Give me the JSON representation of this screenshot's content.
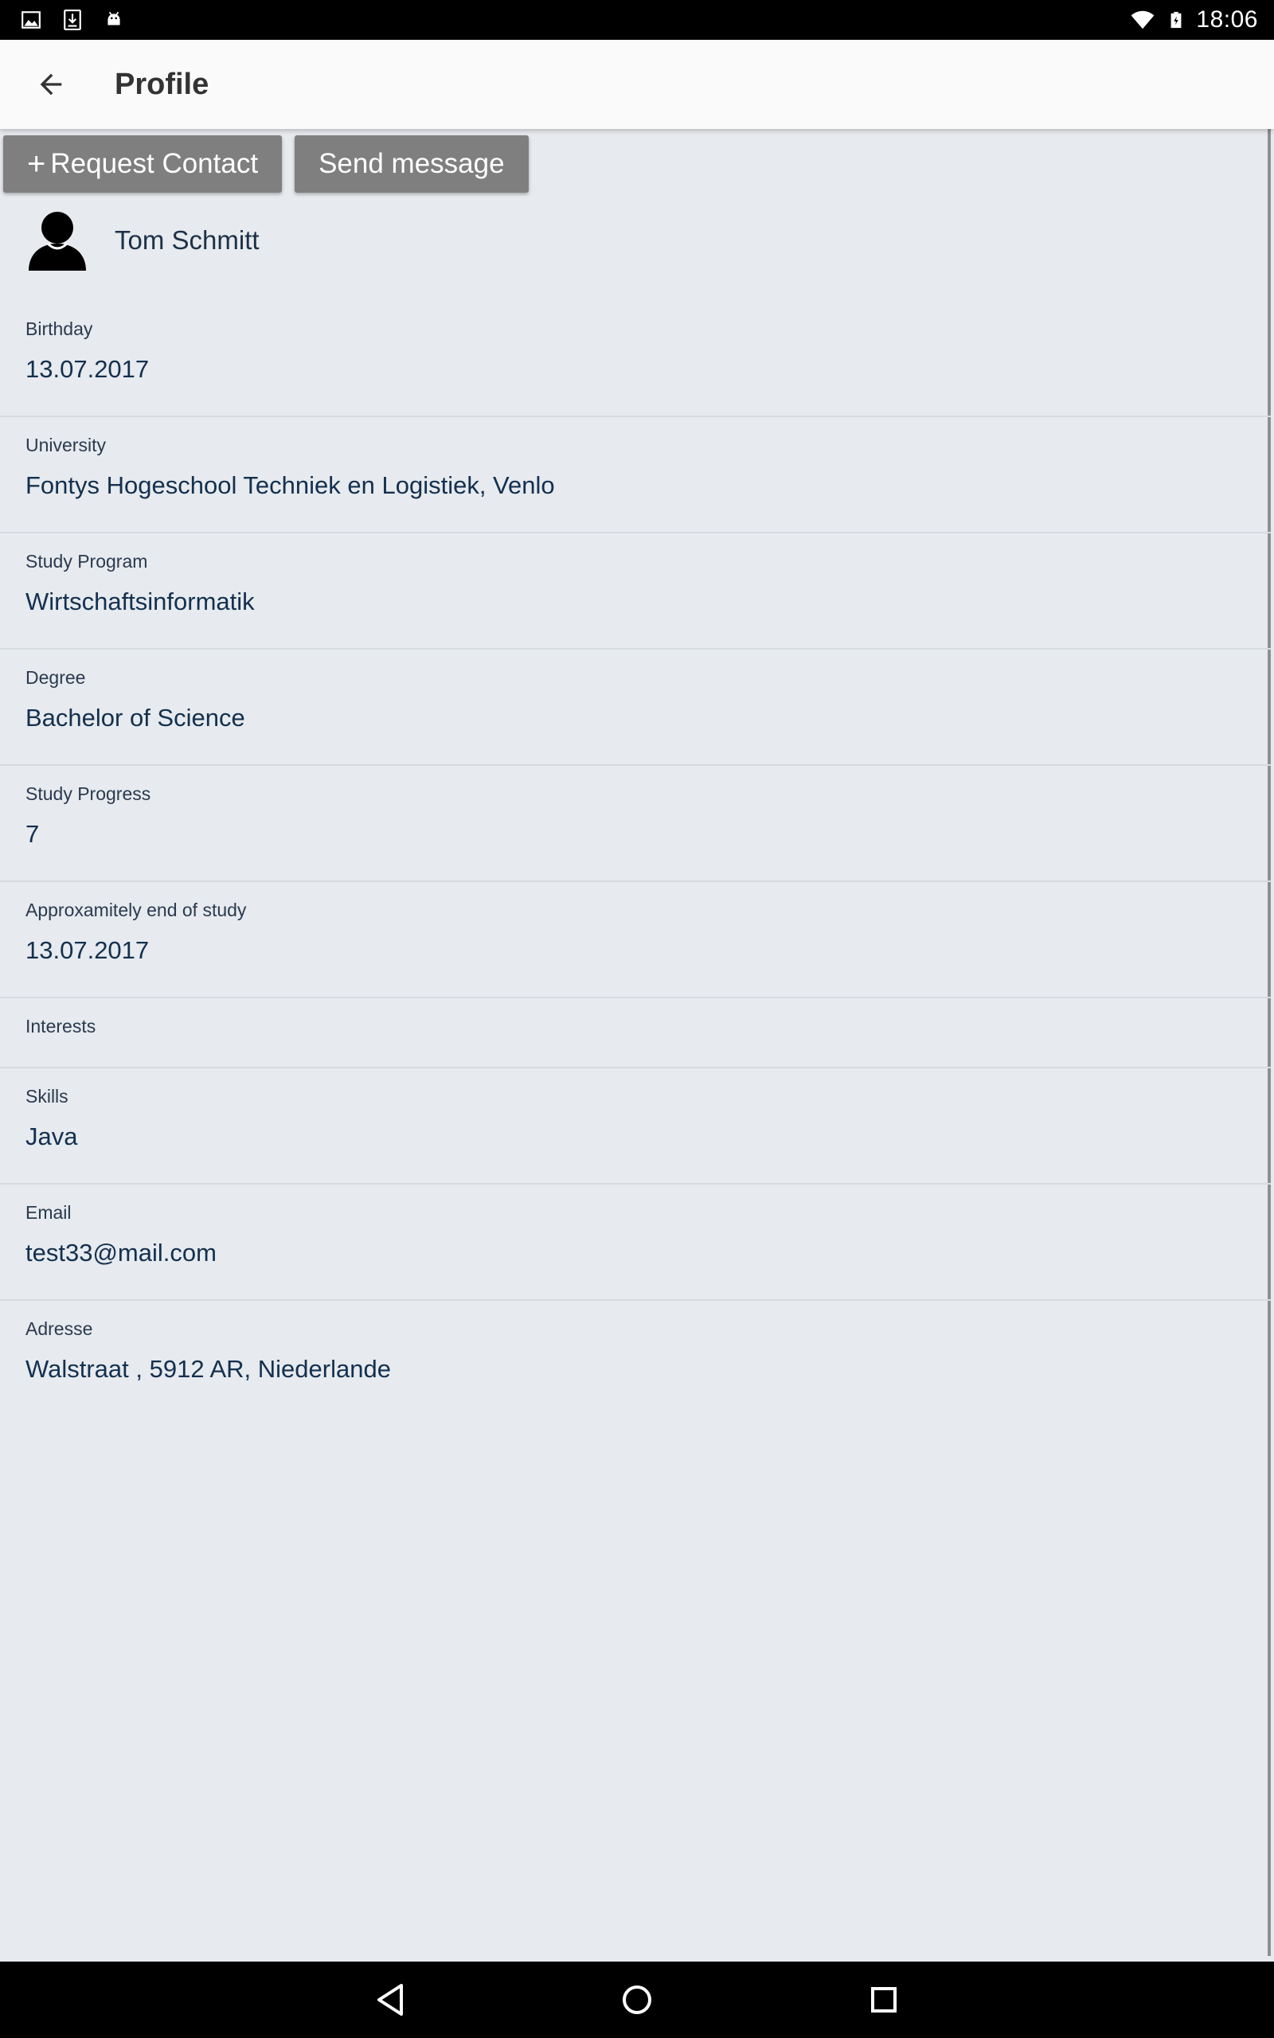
{
  "status_bar": {
    "time": "18:06",
    "left_icons": [
      "image-icon",
      "download-icon",
      "android-icon"
    ],
    "right_icons": [
      "wifi-icon",
      "battery-icon"
    ]
  },
  "app_bar": {
    "title": "Profile",
    "back_icon": "arrow-back-icon"
  },
  "actions": {
    "request_contact_label": "Request Contact",
    "request_contact_icon": "+",
    "send_message_label": "Send message"
  },
  "profile": {
    "name": "Tom Schmitt",
    "avatar_icon": "person-icon"
  },
  "fields": [
    {
      "label": "Birthday",
      "value": "13.07.2017"
    },
    {
      "label": "University",
      "value": "Fontys Hogeschool Techniek en Logistiek, Venlo"
    },
    {
      "label": "Study Program",
      "value": "Wirtschaftsinformatik"
    },
    {
      "label": "Degree",
      "value": "Bachelor of Science"
    },
    {
      "label": "Study Progress",
      "value": "7"
    },
    {
      "label": "Approxamitely end of study",
      "value": "13.07.2017"
    },
    {
      "label": "Interests",
      "value": ""
    },
    {
      "label": "Skills",
      "value": "Java"
    },
    {
      "label": "Email",
      "value": "test33@mail.com"
    },
    {
      "label": "Adresse",
      "value": "Walstraat , 5912 AR, Niederlande"
    }
  ],
  "nav_bar": {
    "icons": [
      "nav-back-icon",
      "nav-home-icon",
      "nav-recents-icon"
    ]
  },
  "colors": {
    "background": "#e7eaee",
    "app_bar": "#fafafa",
    "button": "#7f7f7f",
    "text": "#13304f"
  }
}
